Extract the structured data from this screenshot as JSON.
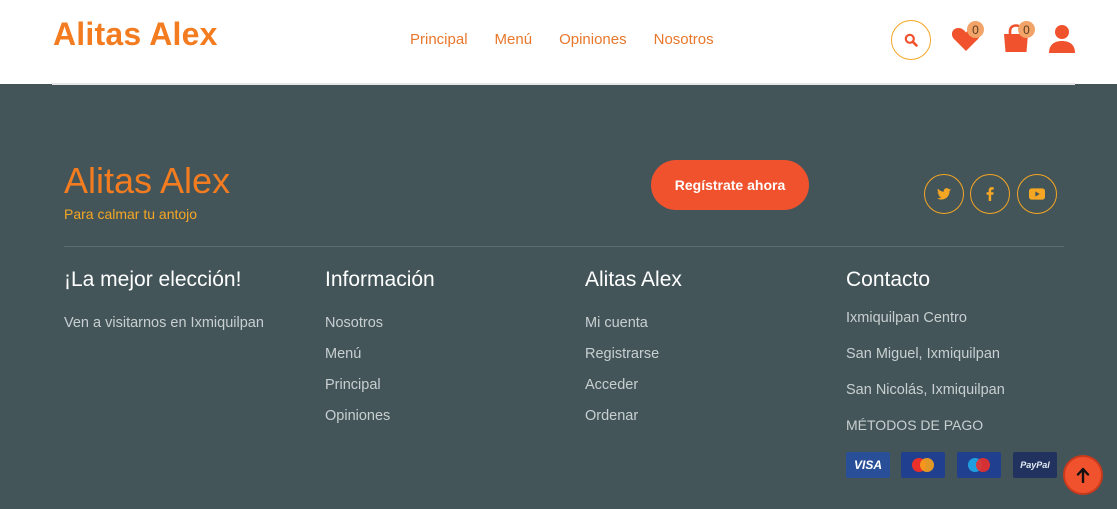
{
  "header": {
    "logo": "Alitas Alex",
    "nav": [
      "Principal",
      "Menú",
      "Opiniones",
      "Nosotros"
    ],
    "wishlist_count": "0",
    "cart_count": "0"
  },
  "footer": {
    "brand": "Alitas Alex",
    "tagline": "Para calmar tu antojo",
    "register_label": "Regístrate ahora",
    "col1": {
      "title": "¡La mejor elección!",
      "text": "Ven a visitarnos en Ixmiquilpan"
    },
    "col2": {
      "title": "Información",
      "links": [
        "Nosotros",
        "Menú",
        "Principal",
        "Opiniones"
      ]
    },
    "col3": {
      "title": "Alitas Alex",
      "links": [
        "Mi cuenta",
        "Registrarse",
        "Acceder",
        "Ordenar"
      ]
    },
    "col4": {
      "title": "Contacto",
      "lines": [
        "Ixmiquilpan Centro",
        "San Miguel, Ixmiquilpan",
        "San Nicolás, Ixmiquilpan"
      ],
      "payment_title": "MÉTODOS DE PAGO",
      "payments": [
        "VISA",
        "MasterCard",
        "Maestro",
        "PayPal"
      ]
    }
  },
  "colors": {
    "brand_orange": "#f47c20",
    "accent_red": "#f0522e",
    "footer_bg": "#435559"
  }
}
